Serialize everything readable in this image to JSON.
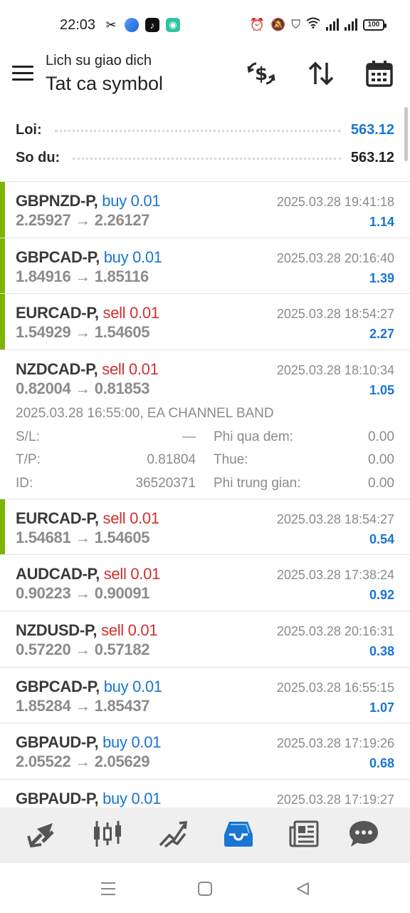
{
  "status_bar": {
    "time": "22:03",
    "battery": "100",
    "icons": [
      "capcut-icon",
      "app-blue-icon",
      "tiktok-icon",
      "app-teal-icon",
      "alarm-icon",
      "mute-icon",
      "shield-icon",
      "wifi-icon",
      "signal-icon",
      "signal-icon"
    ]
  },
  "header": {
    "subtitle": "Lich su giao dich",
    "title": "Tat ca symbol",
    "actions": [
      "currency-exchange-icon",
      "sort-icon",
      "calendar-icon"
    ]
  },
  "summary": {
    "profit_label": "Loi:",
    "profit_value": "563.12",
    "balance_label": "So du:",
    "balance_value": "563.12"
  },
  "colors": {
    "accent_green": "#7cb500",
    "buy_blue": "#1976d2",
    "sell_red": "#d32f2f",
    "text_gray": "#8b8b8b"
  },
  "trades": [
    {
      "symbol": "GBPNZD-P,",
      "direction": "buy 0.01",
      "type": "buy",
      "open": "2.25927",
      "arrow": "→",
      "close": "2.26127",
      "datetime": "2025.03.28 19:41:18",
      "profit": "1.14"
    },
    {
      "symbol": "GBPCAD-P,",
      "direction": "buy 0.01",
      "type": "buy",
      "open": "1.84916",
      "arrow": "→",
      "close": "1.85116",
      "datetime": "2025.03.28 20:16:40",
      "profit": "1.39"
    },
    {
      "symbol": "EURCAD-P,",
      "direction": "sell 0.01",
      "type": "sell",
      "open": "1.54929",
      "arrow": "→",
      "close": "1.54605",
      "datetime": "2025.03.28 18:54:27",
      "profit": "2.27"
    },
    {
      "symbol": "NZDCAD-P,",
      "direction": "sell 0.01",
      "type": "sell",
      "open": "0.82004",
      "arrow": "→",
      "close": "0.81853",
      "datetime": "2025.03.28 18:10:34",
      "profit": "1.05",
      "details": {
        "comment": "2025.03.28 16:55:00, EA CHANNEL BAND",
        "sl_label": "S/L:",
        "sl_value": "—",
        "tp_label": "T/P:",
        "tp_value": "0.81804",
        "id_label": "ID:",
        "id_value": "36520371",
        "swap_label": "Phi qua dem:",
        "swap_value": "0.00",
        "tax_label": "Thue:",
        "tax_value": "0.00",
        "commission_label": "Phi trung gian:",
        "commission_value": "0.00"
      }
    },
    {
      "symbol": "EURCAD-P,",
      "direction": "sell 0.01",
      "type": "sell",
      "open": "1.54681",
      "arrow": "→",
      "close": "1.54605",
      "datetime": "2025.03.28 18:54:27",
      "profit": "0.54"
    },
    {
      "symbol": "AUDCAD-P,",
      "direction": "sell 0.01",
      "type": "sell",
      "open": "0.90223",
      "arrow": "→",
      "close": "0.90091",
      "datetime": "2025.03.28 17:38:24",
      "profit": "0.92"
    },
    {
      "symbol": "NZDUSD-P,",
      "direction": "sell 0.01",
      "type": "sell",
      "open": "0.57220",
      "arrow": "→",
      "close": "0.57182",
      "datetime": "2025.03.28 20:16:31",
      "profit": "0.38"
    },
    {
      "symbol": "GBPCAD-P,",
      "direction": "buy 0.01",
      "type": "buy",
      "open": "1.85284",
      "arrow": "→",
      "close": "1.85437",
      "datetime": "2025.03.28 16:55:15",
      "profit": "1.07"
    },
    {
      "symbol": "GBPAUD-P,",
      "direction": "buy 0.01",
      "type": "buy",
      "open": "2.05522",
      "arrow": "→",
      "close": "2.05629",
      "datetime": "2025.03.28 17:19:26",
      "profit": "0.68"
    },
    {
      "symbol": "GBPAUD-P,",
      "direction": "buy 0.01",
      "type": "buy",
      "open": "",
      "arrow": "",
      "close": "",
      "datetime": "2025.03.28 17:19:27",
      "profit": ""
    }
  ],
  "bottom_nav": [
    "quotes-icon",
    "chart-icon",
    "trade-icon",
    "history-icon",
    "news-icon",
    "chat-icon"
  ],
  "active_tab": "history-icon",
  "system_nav": [
    "recents-icon",
    "home-icon",
    "back-icon"
  ]
}
